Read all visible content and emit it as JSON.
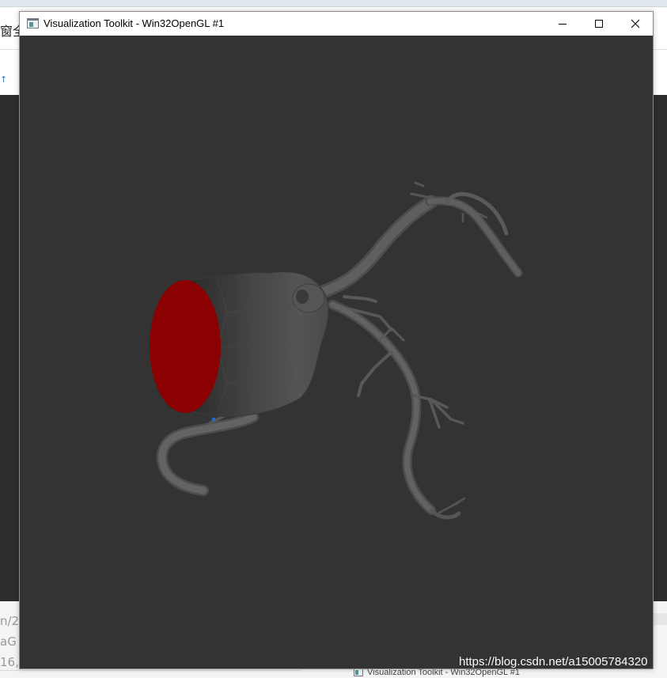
{
  "background_app": {
    "left_text": "窗全",
    "arrow_glyph": "↑",
    "fragments": [
      "n/20",
      "aG",
      "16,c"
    ]
  },
  "window": {
    "title": "Visualization Toolkit - Win32OpenGL #1",
    "icon": "app-window-icon",
    "controls": {
      "minimize": "minimize-icon",
      "maximize": "maximize-icon",
      "close": "close-icon"
    }
  },
  "viewport": {
    "background_color": "#333333",
    "vessel_color": "#5e5e5e",
    "cap_color": "#8b0000",
    "marker_color": "#1a6bd4"
  },
  "taskbar": {
    "label": "Visualization Toolkit - Win32OpenGL #1"
  },
  "watermark": "https://blog.csdn.net/a15005784320"
}
